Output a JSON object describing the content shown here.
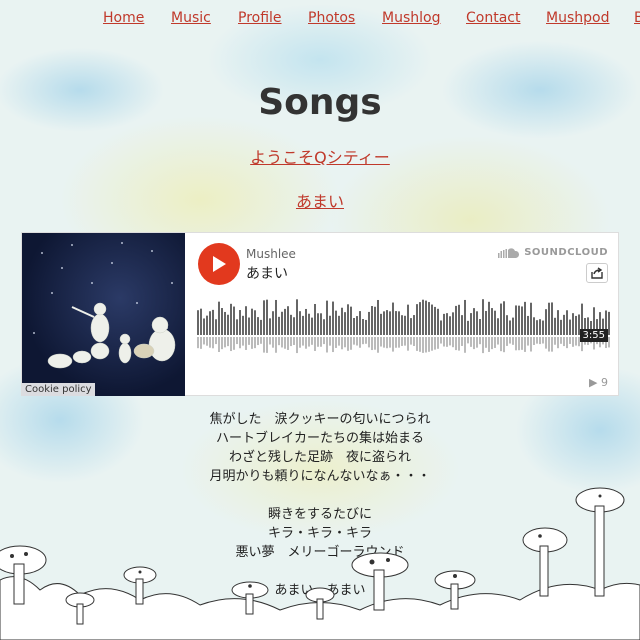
{
  "nav": {
    "items": [
      "Home",
      "Music",
      "Profile",
      "Photos",
      "Mushlog",
      "Contact",
      "Mushpod",
      "B"
    ]
  },
  "page": {
    "title": "Songs",
    "links": [
      "ようこそQシティー",
      "あまい"
    ]
  },
  "player": {
    "artist": "Mushlee",
    "track": "あまい",
    "brand": "SOUNDCLOUD",
    "duration": "3:55",
    "plays": "9",
    "cookie_policy": "Cookie policy",
    "colors": {
      "play": "#e2391e"
    }
  },
  "lyrics": [
    "焦がした　涙クッキーの匂いにつられ",
    "ハートブレイカーたちの集は始まる",
    "わざと残した足跡　夜に盗られ",
    "月明かりも頼りになんないなぁ・・・",
    "",
    "瞬きをするたびに",
    "キラ・キラ・キラ",
    "悪い夢　メリーゴーラウンド",
    "",
    "あまい　あまい"
  ]
}
